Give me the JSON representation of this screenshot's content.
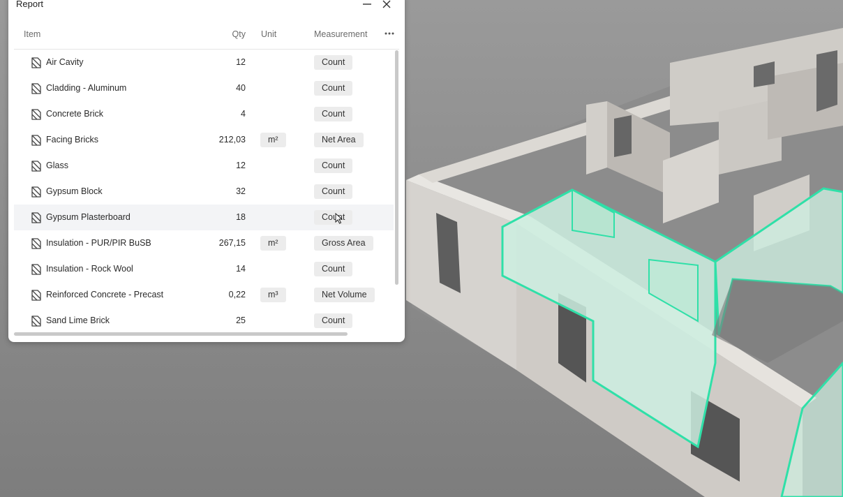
{
  "panel": {
    "title": "Report",
    "columns": {
      "item": "Item",
      "qty": "Qty",
      "unit": "Unit",
      "measurement": "Measurement"
    },
    "rows": [
      {
        "name": "Air Cavity",
        "qty": "12",
        "unit": "",
        "measurement": "Count"
      },
      {
        "name": "Cladding - Aluminum",
        "qty": "40",
        "unit": "",
        "measurement": "Count"
      },
      {
        "name": "Concrete Brick",
        "qty": "4",
        "unit": "",
        "measurement": "Count"
      },
      {
        "name": "Facing Bricks",
        "qty": "212,03",
        "unit": "m²",
        "measurement": "Net Area"
      },
      {
        "name": "Glass",
        "qty": "12",
        "unit": "",
        "measurement": "Count"
      },
      {
        "name": "Gypsum Block",
        "qty": "32",
        "unit": "",
        "measurement": "Count"
      },
      {
        "name": "Gypsum Plasterboard",
        "qty": "18",
        "unit": "",
        "measurement": "Count"
      },
      {
        "name": "Insulation - PUR/PIR BuSB",
        "qty": "267,15",
        "unit": "m²",
        "measurement": "Gross Area"
      },
      {
        "name": "Insulation - Rock Wool",
        "qty": "14",
        "unit": "",
        "measurement": "Count"
      },
      {
        "name": "Reinforced Concrete - Precast",
        "qty": "0,22",
        "unit": "m³",
        "measurement": "Net Volume"
      },
      {
        "name": "Sand Lime Brick",
        "qty": "25",
        "unit": "",
        "measurement": "Count"
      }
    ]
  },
  "colors": {
    "highlight": "#2fe0a8",
    "highlight_fill": "#cdeee0",
    "background": "#8a8a8a"
  },
  "icons": {
    "row": "material-icon",
    "minimize": "minimize-icon",
    "close": "close-icon",
    "more": "more-horizontal-icon"
  }
}
